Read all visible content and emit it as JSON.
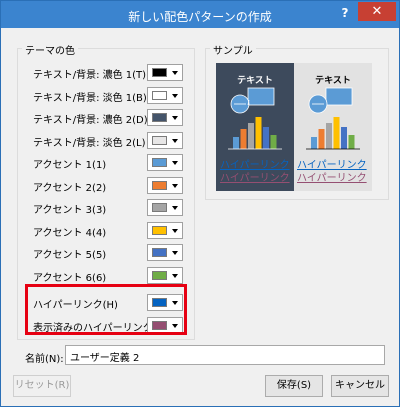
{
  "window": {
    "title": "新しい配色パターンの作成",
    "help": "?",
    "close": "✕"
  },
  "theme_colors": {
    "title": "テーマの色",
    "rows": [
      {
        "label": "テキスト/背景: 濃色 1(T)",
        "color": "#000000"
      },
      {
        "label": "テキスト/背景: 淡色 1(B)",
        "color": "#ffffff"
      },
      {
        "label": "テキスト/背景: 濃色 2(D)",
        "color": "#44546a"
      },
      {
        "label": "テキスト/背景: 淡色 2(L)",
        "color": "#e7e6e6"
      },
      {
        "label": "アクセント 1(1)",
        "color": "#5b9bd5"
      },
      {
        "label": "アクセント 2(2)",
        "color": "#ed7d31"
      },
      {
        "label": "アクセント 3(3)",
        "color": "#a5a5a5"
      },
      {
        "label": "アクセント 4(4)",
        "color": "#ffc000"
      },
      {
        "label": "アクセント 5(5)",
        "color": "#4472c4"
      },
      {
        "label": "アクセント 6(6)",
        "color": "#70ad47"
      },
      {
        "label": "ハイパーリンク(H)",
        "color": "#0563c1"
      },
      {
        "label": "表示済みのハイパーリンク(F)",
        "color": "#954f72"
      }
    ]
  },
  "sample": {
    "title": "サンプル",
    "text": "テキスト",
    "hyperlink": "ハイパーリンク",
    "visited_hyperlink": "ハイパーリンク",
    "bar_colors": [
      "#5b9bd5",
      "#ed7d31",
      "#a5a5a5",
      "#ffc000",
      "#4472c4",
      "#70ad47"
    ]
  },
  "name": {
    "label": "名前(N):",
    "value": "ユーザー定義 2"
  },
  "buttons": {
    "reset": "リセット(R)",
    "save": "保存(S)",
    "cancel": "キャンセル"
  }
}
